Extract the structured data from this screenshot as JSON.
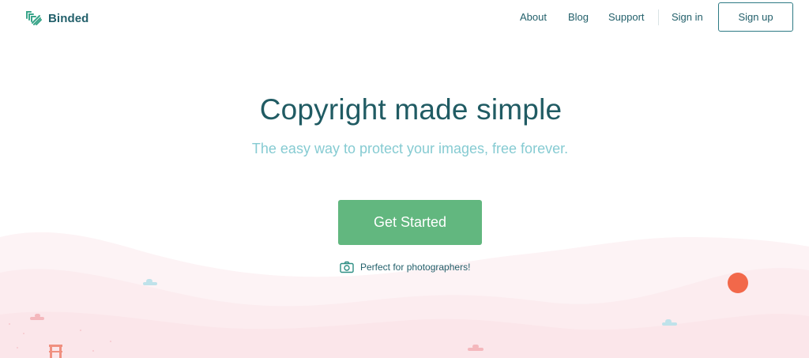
{
  "brand": {
    "name": "Binded",
    "logo_icon": "binded-logo-icon"
  },
  "nav": {
    "about": "About",
    "blog": "Blog",
    "support": "Support",
    "signin": "Sign in",
    "signup": "Sign up"
  },
  "hero": {
    "title": "Copyright made simple",
    "subtitle": "The easy way to protect your images, free forever.",
    "cta": "Get Started",
    "photographers_note": "Perfect for photographers!",
    "note_icon": "camera-icon"
  },
  "colors": {
    "brand_teal": "#23606b",
    "subtitle_teal": "#86cbd2",
    "cta_green": "#62b77f",
    "sun_coral": "#f2684a",
    "hills_pink": "#fcebee",
    "bridge_red": "#f09080"
  }
}
